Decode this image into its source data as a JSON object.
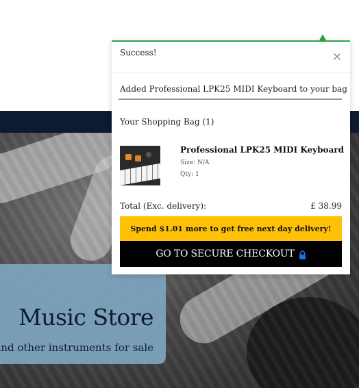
{
  "toast": {
    "title": "Success!",
    "close_icon": "close-icon",
    "message": "Added Professional LPK25 MIDI Keyboard to your bag",
    "accent_color": "#28a745"
  },
  "bag": {
    "title": "Your Shopping Bag (1)",
    "items": [
      {
        "name": "Professional LPK25 MIDI Keyboard",
        "size": "Size: N/A",
        "qty": "Qty: 1"
      }
    ],
    "total_label": "Total (Exc. delivery):",
    "total_value": "£ 38.99",
    "delivery_banner": "Spend $1.01 more to get free next day delivery!",
    "checkout_label": "GO TO SECURE CHECKOUT",
    "checkout_icon": "lock-icon",
    "banner_color": "#ffc107"
  },
  "hero": {
    "title": "Music Store",
    "subtitle": "and other instruments for sale"
  },
  "theme": {
    "nav_color": "#0d1a30"
  }
}
